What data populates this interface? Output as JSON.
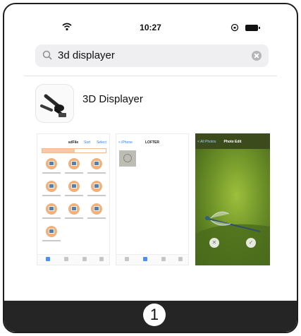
{
  "status_bar": {
    "time": "10:27"
  },
  "search": {
    "query": "3d displayer"
  },
  "result": {
    "app_name": "3D Displayer"
  },
  "screenshots": {
    "shot1": {
      "title": "sdFile",
      "left_link": "Sort",
      "right_link": "Select"
    },
    "shot2": {
      "back": "< iPhone",
      "title": "LOFTER"
    },
    "shot3": {
      "back": "< All Photos",
      "title": "Photo Edit"
    }
  },
  "footer": {
    "page_number": "1"
  }
}
